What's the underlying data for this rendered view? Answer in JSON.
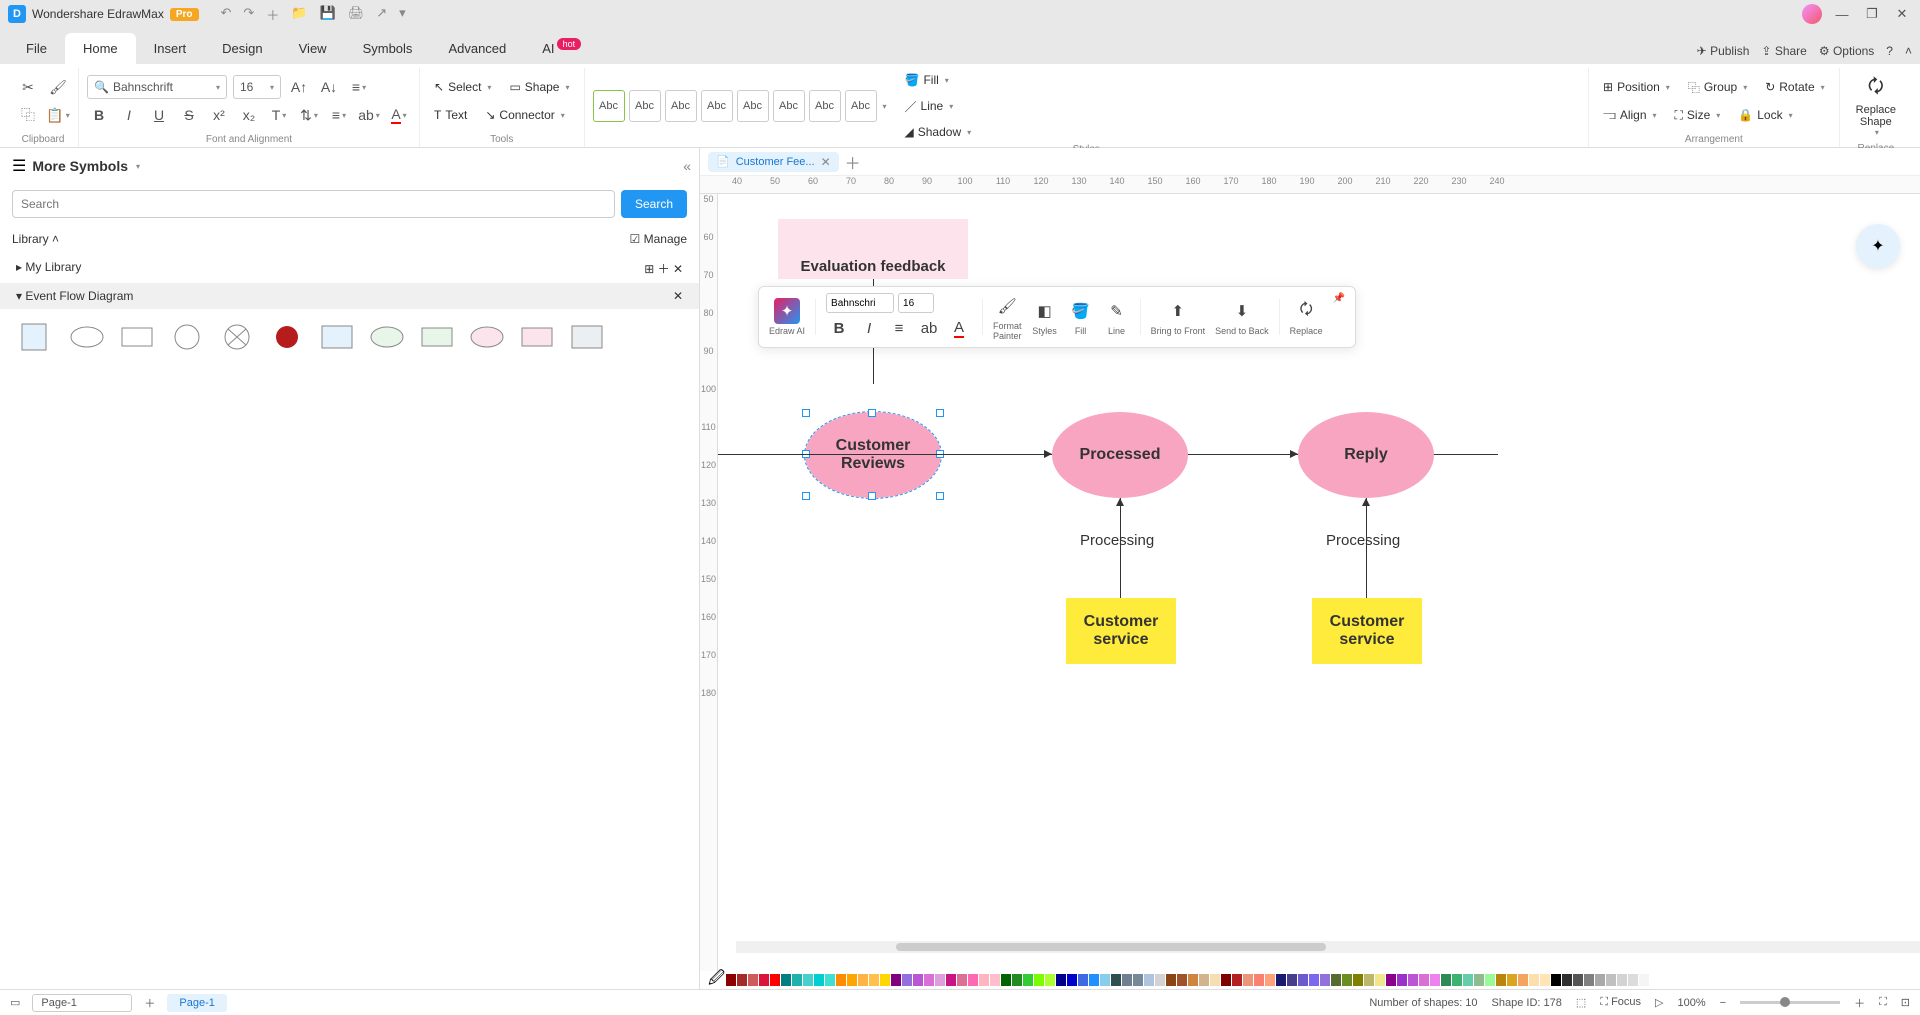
{
  "titlebar": {
    "app_name": "Wondershare EdrawMax",
    "badge": "Pro"
  },
  "menu": {
    "tabs": [
      "File",
      "Home",
      "Insert",
      "Design",
      "View",
      "Symbols",
      "Advanced",
      "AI"
    ],
    "active": 1,
    "ai_badge": "hot",
    "right": {
      "publish": "Publish",
      "share": "Share",
      "options": "Options"
    }
  },
  "ribbon": {
    "font_name": "Bahnschrift",
    "font_size": "16",
    "select": "Select",
    "shape": "Shape",
    "text": "Text",
    "connector": "Connector",
    "fill": "Fill",
    "line": "Line",
    "shadow": "Shadow",
    "position": "Position",
    "group": "Group",
    "rotate": "Rotate",
    "align": "Align",
    "size": "Size",
    "lock": "Lock",
    "replace": "Replace\nShape",
    "groups": {
      "clipboard": "Clipboard",
      "font": "Font and Alignment",
      "tools": "Tools",
      "styles": "Styles",
      "arrangement": "Arrangement",
      "replace_g": "Replace"
    },
    "style_thumbs": [
      "Abc",
      "Abc",
      "Abc",
      "Abc",
      "Abc",
      "Abc",
      "Abc",
      "Abc"
    ]
  },
  "sidebar": {
    "title": "More Symbols",
    "search_placeholder": "Search",
    "search_btn": "Search",
    "library": "Library",
    "manage": "Manage",
    "my_library": "My Library",
    "section": "Event Flow Diagram"
  },
  "doc": {
    "tab_name": "Customer Fee..."
  },
  "rulers": {
    "h": [
      "40",
      "50",
      "60",
      "70",
      "80",
      "90",
      "100",
      "110",
      "120",
      "130",
      "140",
      "150",
      "160",
      "170",
      "180",
      "190",
      "200",
      "210",
      "220",
      "230",
      "240"
    ],
    "v": [
      "50",
      "60",
      "70",
      "80",
      "90",
      "100",
      "110",
      "120",
      "130",
      "140",
      "150",
      "160",
      "170",
      "180"
    ]
  },
  "diagram": {
    "note": "Evaluation feedback",
    "oval1": "Customer\nReviews",
    "oval2": "Processed",
    "oval3": "Reply",
    "proc1": "Processing",
    "proc2": "Processing",
    "rect1": "Customer\nservice",
    "rect2": "Customer\nservice"
  },
  "float_tb": {
    "edraw_ai": "Edraw AI",
    "font_name": "Bahnschri",
    "font_size": "16",
    "format_painter": "Format\nPainter",
    "styles": "Styles",
    "fill": "Fill",
    "line": "Line",
    "bring_front": "Bring to Front",
    "send_back": "Send to Back",
    "replace": "Replace"
  },
  "status": {
    "page_sel": "Page-1",
    "page_tab": "Page-1",
    "shapes": "Number of shapes: 10",
    "shape_id": "Shape ID: 178",
    "focus": "Focus",
    "zoom": "100%"
  },
  "colors": [
    "#8b0000",
    "#a52a2a",
    "#cd5c5c",
    "#dc143c",
    "#ff0000",
    "#008080",
    "#20b2aa",
    "#48d1cc",
    "#00ced1",
    "#40e0d0",
    "#ff8c00",
    "#ffa500",
    "#ffb347",
    "#ffc04c",
    "#ffd700",
    "#800080",
    "#9370db",
    "#ba55d3",
    "#da70d6",
    "#dda0dd",
    "#c71585",
    "#db7093",
    "#ff69b4",
    "#ffb6c1",
    "#ffc0cb",
    "#006400",
    "#228b22",
    "#32cd32",
    "#7cfc00",
    "#adff2f",
    "#00008b",
    "#0000cd",
    "#4169e1",
    "#1e90ff",
    "#87ceeb",
    "#2f4f4f",
    "#708090",
    "#778899",
    "#b0c4de",
    "#d3d3d3",
    "#8b4513",
    "#a0522d",
    "#cd853f",
    "#d2b48c",
    "#f5deb3",
    "#800000",
    "#b22222",
    "#e9967a",
    "#fa8072",
    "#ffa07a",
    "#191970",
    "#483d8b",
    "#6a5acd",
    "#7b68ee",
    "#9370db",
    "#556b2f",
    "#6b8e23",
    "#808000",
    "#bdb76b",
    "#f0e68c",
    "#8b008b",
    "#9932cc",
    "#ba55d3",
    "#da70d6",
    "#ee82ee",
    "#2e8b57",
    "#3cb371",
    "#66cdaa",
    "#8fbc8f",
    "#98fb98",
    "#b8860b",
    "#daa520",
    "#f4a460",
    "#ffdead",
    "#ffe4b5",
    "#000000",
    "#2f2f2f",
    "#555555",
    "#808080",
    "#a9a9a9",
    "#c0c0c0",
    "#d3d3d3",
    "#dcdcdc",
    "#f5f5f5",
    "#ffffff"
  ]
}
